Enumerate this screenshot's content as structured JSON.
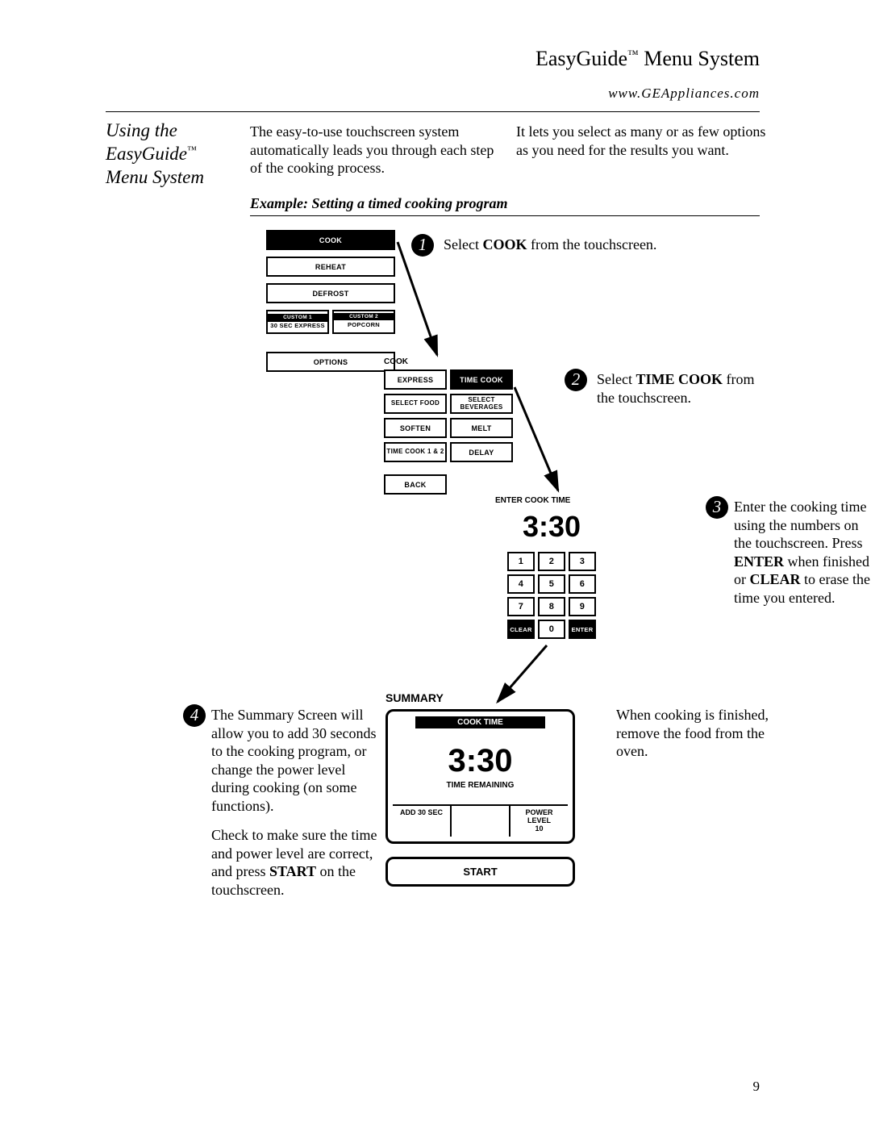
{
  "header": {
    "title_pre": "EasyGuide",
    "title_suf": " Menu System",
    "tm": "™",
    "url": "www.GEAppliances.com"
  },
  "section_title": {
    "line1": "Using the",
    "line2_pre": "EasyGuide",
    "line2_tm": "™",
    "line3": "Menu System"
  },
  "intro_left": "The easy-to-use touchscreen system automatically leads you through each step of the cooking process.",
  "intro_right": "It lets you select as many or as few options as you need for the results you want.",
  "example_heading": "Example: Setting a timed cooking program",
  "bubbles": {
    "b1": "1",
    "b2": "2",
    "b3": "3",
    "b4": "4"
  },
  "step1_text_pre": "Select ",
  "step1_bold": "COOK",
  "step1_text_post": " from the touchscreen.",
  "step2_text_pre": "Select ",
  "step2_bold": "TIME COOK",
  "step2_text_post": " from the touchscreen.",
  "step3_text_a": "Enter the cooking time using the numbers on the touchscreen. Press ",
  "step3_bold1": "ENTER",
  "step3_text_b": " when finished or ",
  "step3_bold2": "CLEAR",
  "step3_text_c": " to erase the time you entered.",
  "step4_left_a": "The Summary Screen will allow you to add 30 seconds to the cooking program, or change the power level during cooking (on some functions).",
  "step4_left_b_pre": "Check to make sure the time and power level are correct, and press ",
  "step4_left_b_bold": "START",
  "step4_left_b_post": " on the touchscreen.",
  "step4_right": "When cooking is finished, remove the food from the oven.",
  "screen1": {
    "cook": "COOK",
    "reheat": "REHEAT",
    "defrost": "DEFROST",
    "custom1_top": "CUSTOM 1",
    "custom1_bot": "30 SEC EXPRESS",
    "custom2_top": "CUSTOM 2",
    "custom2_bot": "POPCORN",
    "options": "OPTIONS"
  },
  "screen2": {
    "title": "COOK",
    "express": "EXPRESS",
    "timecook": "TIME COOK",
    "selectfood": "SELECT FOOD",
    "selectbev": "SELECT BEVERAGES",
    "soften": "SOFTEN",
    "melt": "MELT",
    "timecook12": "TIME COOK 1 & 2",
    "delay": "DELAY",
    "back": "BACK"
  },
  "screen3": {
    "title": "ENTER COOK TIME",
    "time": "3:30",
    "k1": "1",
    "k2": "2",
    "k3": "3",
    "k4": "4",
    "k5": "5",
    "k6": "6",
    "k7": "7",
    "k8": "8",
    "k9": "9",
    "clear": "CLEAR",
    "k0": "0",
    "enter": "ENTER"
  },
  "screen4": {
    "title": "SUMMARY",
    "cooktime_label": "COOK TIME",
    "time": "3:30",
    "remaining": "TIME REMAINING",
    "add30": "ADD 30 SEC",
    "middle": "",
    "power_a": "POWER",
    "power_b": "LEVEL",
    "power_c": "10",
    "start": "START"
  },
  "page_number": "9"
}
